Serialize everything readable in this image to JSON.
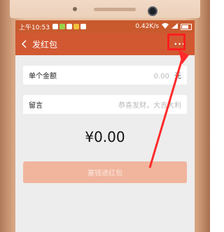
{
  "status": {
    "time": "上午10:53",
    "speed": "0.42K/s"
  },
  "nav": {
    "title": "发红包",
    "more_label": "···"
  },
  "form": {
    "single_amount_label": "单个金额",
    "single_amount_value": "0.00",
    "single_amount_unit": "元",
    "message_label": "留言",
    "message_placeholder": "恭喜发财，大吉大利"
  },
  "total": "¥0.00",
  "send_button": "塞钱进红包",
  "colors": {
    "nav": "#d25832",
    "status": "#c95a2e",
    "button_disabled": "#f1b59e",
    "annotation": "#ff1f1f"
  }
}
